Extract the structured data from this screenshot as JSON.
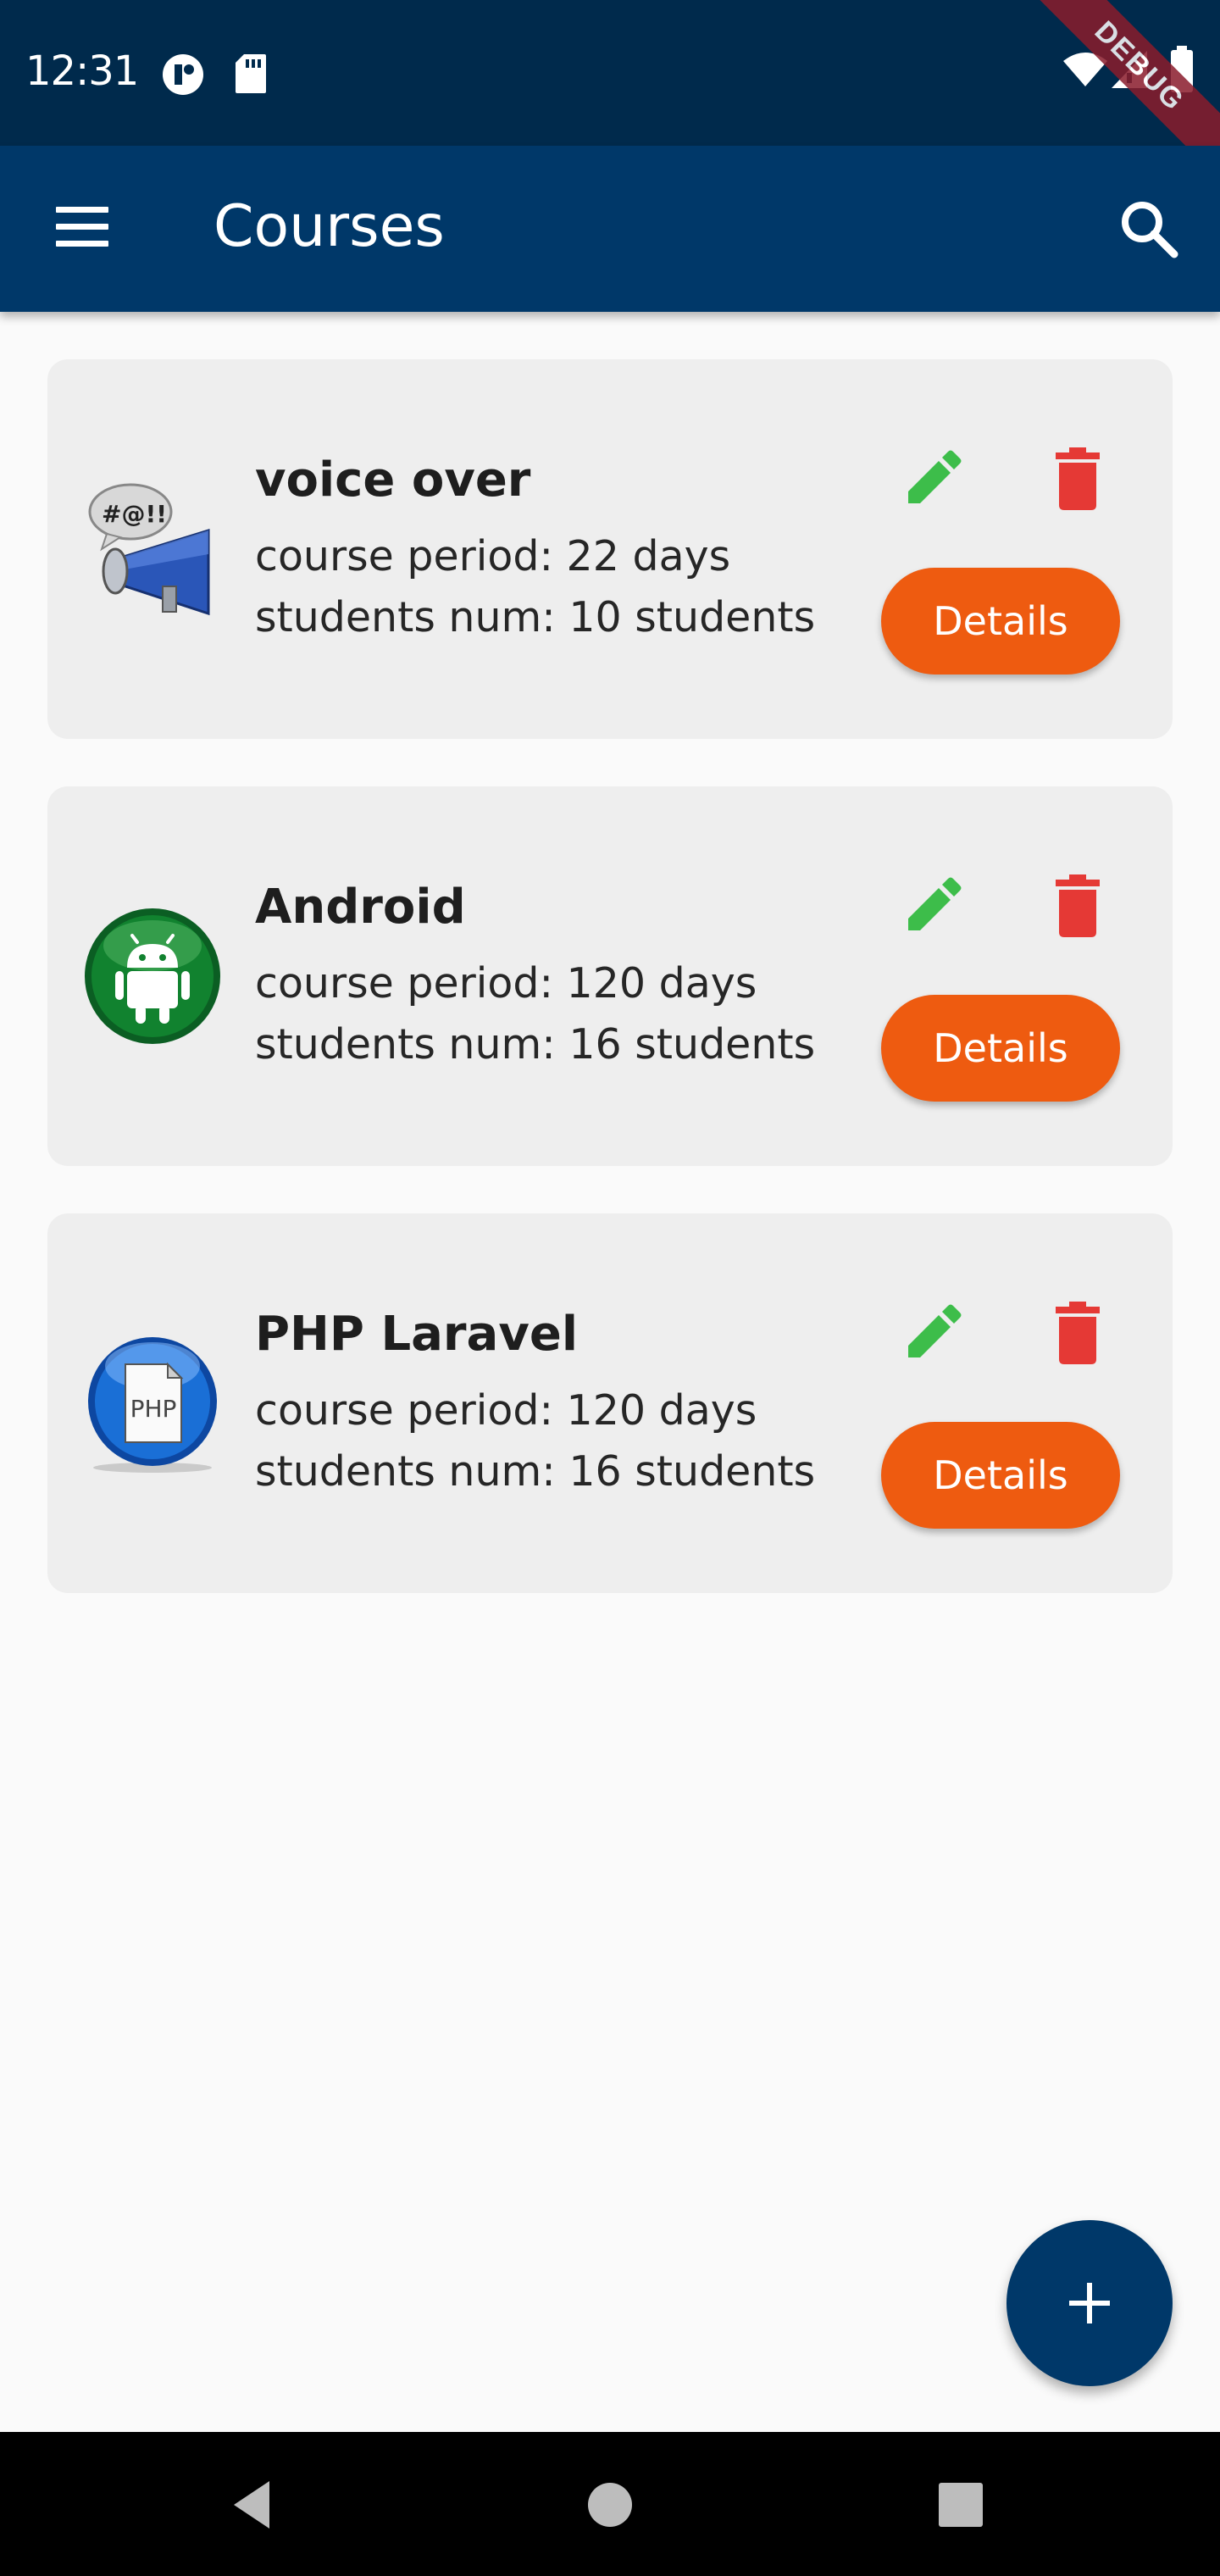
{
  "status_bar": {
    "time": "12:31",
    "debug_label": "DEBUG"
  },
  "app_bar": {
    "title": "Courses",
    "menu_icon": "menu-icon",
    "search_icon": "search-icon"
  },
  "colors": {
    "primary": "#003869",
    "status_bar": "#002a4c",
    "accent": "#ee5b10",
    "edit_green": "#3dbd4a",
    "delete_red": "#e53935",
    "card_bg": "#eeeeee"
  },
  "courses": [
    {
      "title": "voice over",
      "period": "course period: 22 days",
      "students": "students num: 10 students",
      "thumbnail_icon": "megaphone-icon",
      "details_label": "Details"
    },
    {
      "title": "Android",
      "period": "course period: 120 days",
      "students": "students num: 16 students",
      "thumbnail_icon": "android-icon",
      "details_label": "Details"
    },
    {
      "title": "PHP Laravel",
      "period": "course period: 120 days",
      "students": "students num: 16 students",
      "thumbnail_icon": "php-icon",
      "details_label": "Details",
      "thumbnail_text": "PHP"
    }
  ],
  "fab": {
    "icon": "add-icon"
  },
  "nav_bar": {
    "back_icon": "back-icon",
    "home_icon": "home-icon",
    "recents_icon": "recents-icon"
  }
}
